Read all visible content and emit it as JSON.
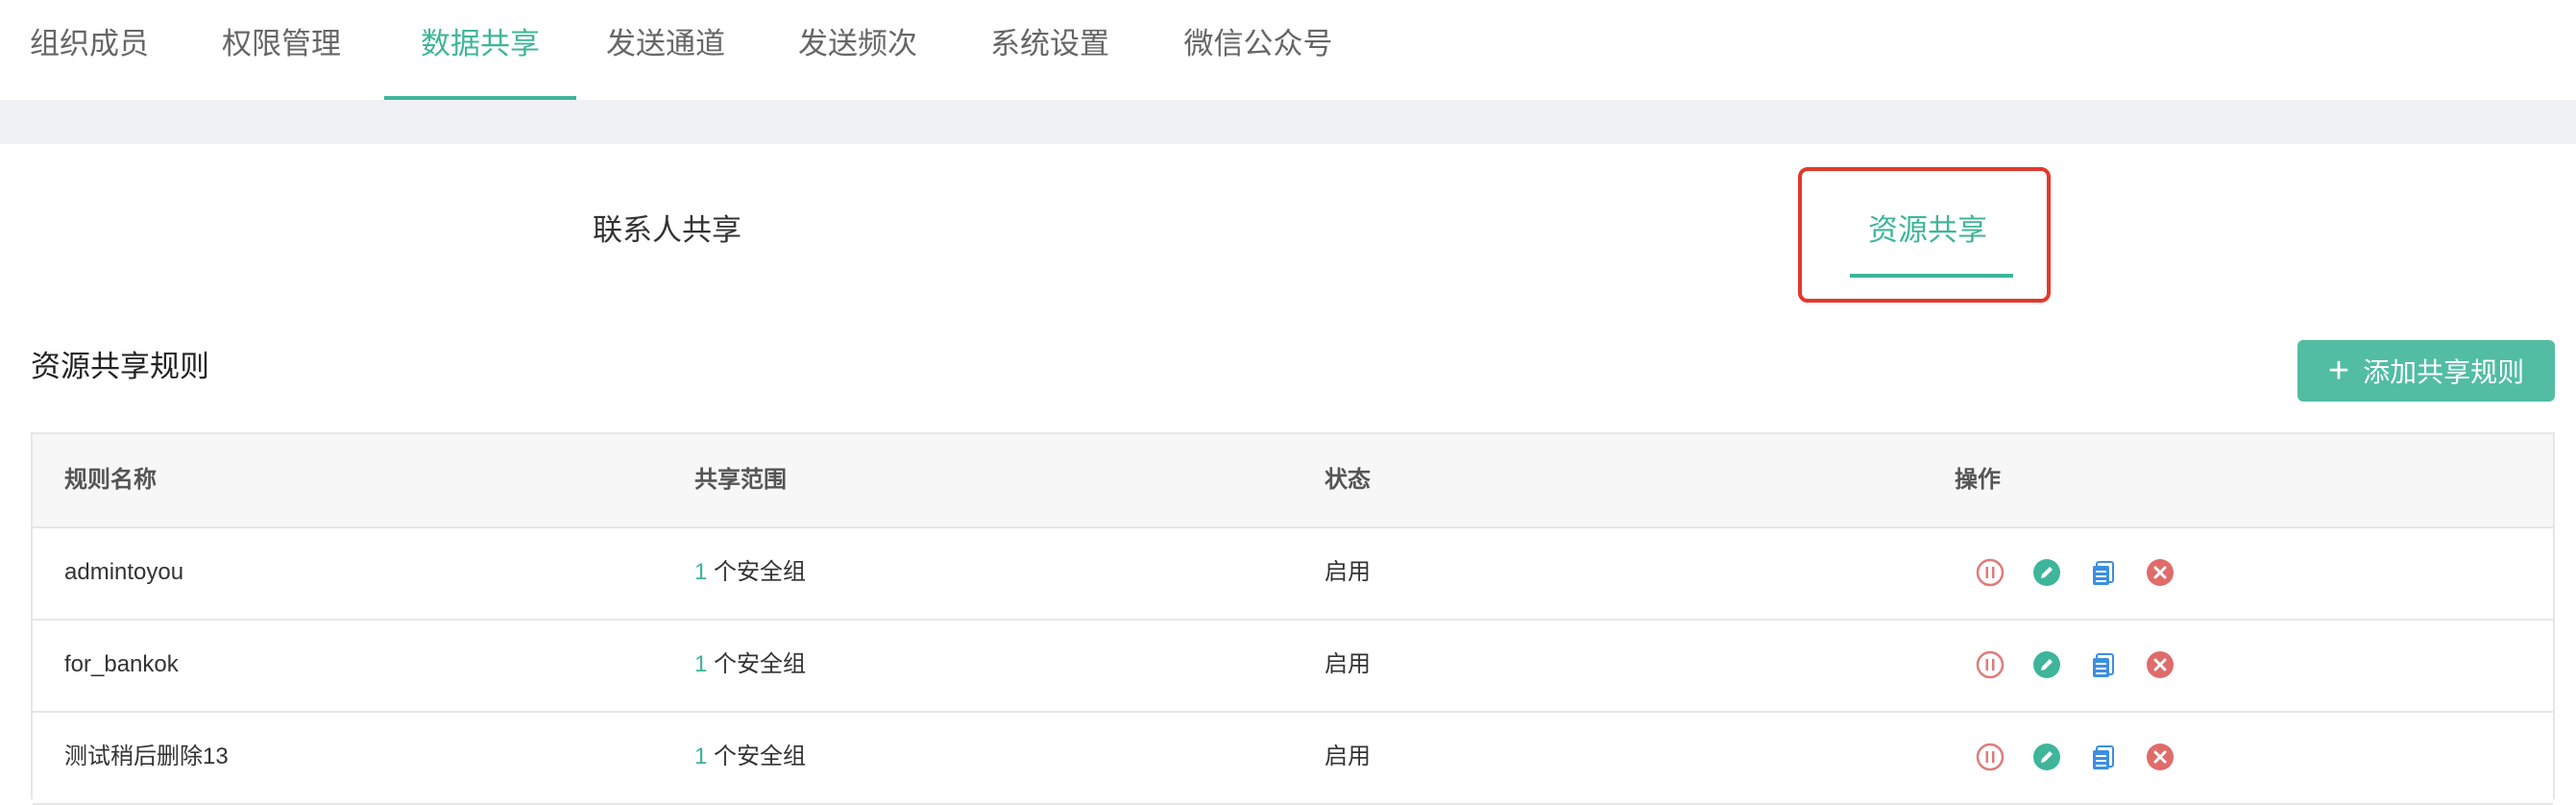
{
  "top_tabs": [
    {
      "label": "组织成员"
    },
    {
      "label": "权限管理"
    },
    {
      "label": "数据共享",
      "active": true
    },
    {
      "label": "发送通道"
    },
    {
      "label": "发送频次"
    },
    {
      "label": "系统设置"
    },
    {
      "label": "微信公众号"
    }
  ],
  "sub_tabs": {
    "contact": "联系人共享",
    "resource": "资源共享",
    "active": "resource"
  },
  "section": {
    "title": "资源共享规则",
    "add_button": "添加共享规则"
  },
  "table": {
    "headers": [
      "规则名称",
      "共享范围",
      "状态",
      "操作"
    ],
    "rows": [
      {
        "name": "admintoyou",
        "scope_count": "1",
        "scope_text": "个安全组",
        "status": "启用"
      },
      {
        "name": "for_bankok",
        "scope_count": "1",
        "scope_text": "个安全组",
        "status": "启用"
      },
      {
        "name": "测试稍后删除13",
        "scope_count": "1",
        "scope_text": "个安全组",
        "status": "启用"
      }
    ]
  },
  "icons": {
    "pause": "pause-icon",
    "edit": "edit-icon",
    "copy": "copy-icon",
    "delete": "delete-icon"
  },
  "colors": {
    "accent": "#3fb59a",
    "button": "#52bda3",
    "pause": "#e07b7b",
    "edit": "#3fb59a",
    "copy": "#3d8fe0",
    "delete": "#e06b6b",
    "highlight": "#e4382c"
  }
}
